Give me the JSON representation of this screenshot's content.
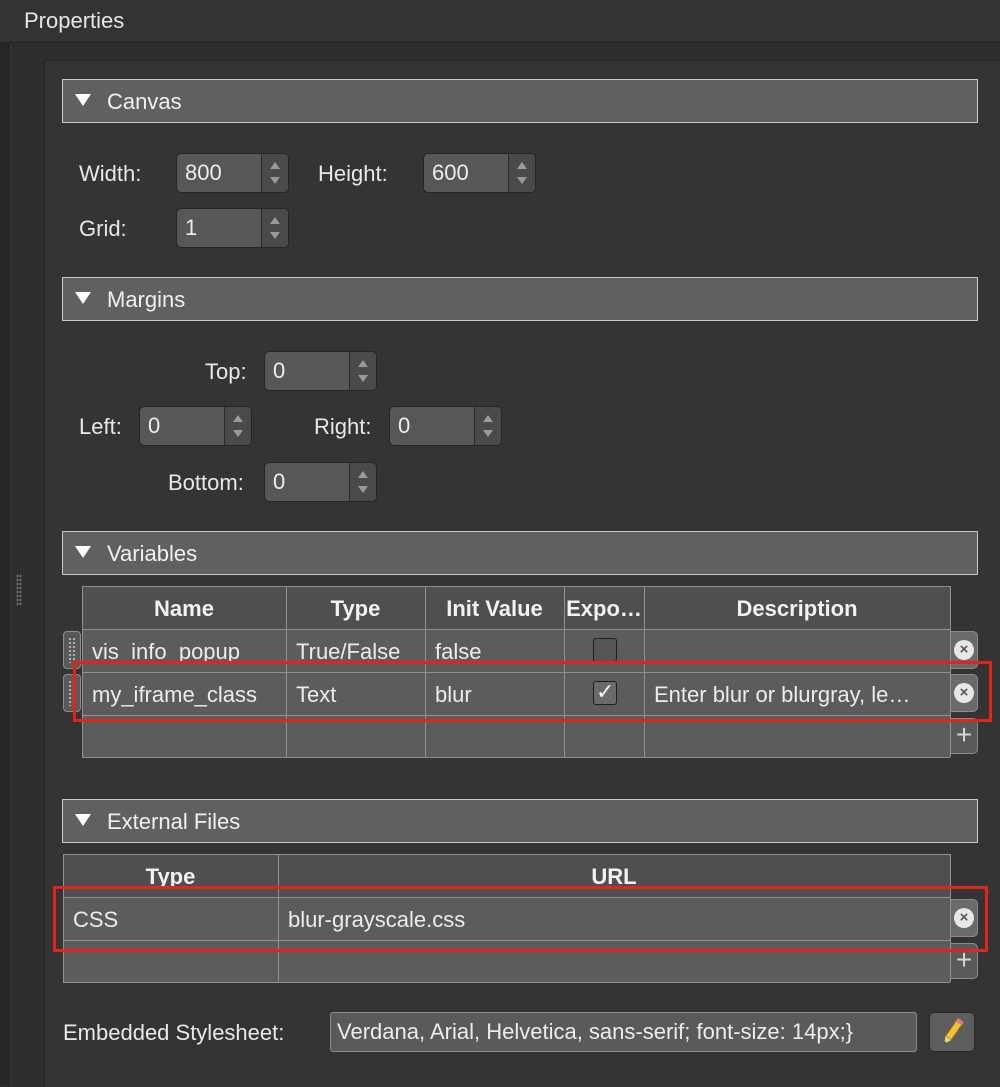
{
  "window": {
    "title": "Properties"
  },
  "canvas": {
    "header": "Canvas",
    "width_label": "Width:",
    "width_value": "800",
    "height_label": "Height:",
    "height_value": "600",
    "grid_label": "Grid:",
    "grid_value": "1"
  },
  "margins": {
    "header": "Margins",
    "top_label": "Top:",
    "top_value": "0",
    "left_label": "Left:",
    "left_value": "0",
    "right_label": "Right:",
    "right_value": "0",
    "bottom_label": "Bottom:",
    "bottom_value": "0"
  },
  "variables": {
    "header": "Variables",
    "columns": [
      "Name",
      "Type",
      "Init Value",
      "Expo…",
      "Description"
    ],
    "rows": [
      {
        "name": "vis_info_popup",
        "type": "True/False",
        "init": "false",
        "exported": false,
        "description": ""
      },
      {
        "name": "my_iframe_class",
        "type": "Text",
        "init": "blur",
        "exported": true,
        "description": "Enter blur or blurgray, le…"
      }
    ],
    "add_label": "+"
  },
  "external_files": {
    "header": "External Files",
    "columns": [
      "Type",
      "URL"
    ],
    "rows": [
      {
        "type": "CSS",
        "url": "blur-grayscale.css"
      }
    ],
    "add_label": "+"
  },
  "embedded_stylesheet": {
    "label": "Embedded Stylesheet:",
    "value": "Verdana, Arial, Helvetica, sans-serif; font-size: 14px;}"
  },
  "icons": {
    "remove": "close-circle-icon",
    "checkmark": "✓",
    "edit": "pencil-icon"
  },
  "colors": {
    "highlight": "#e1251b",
    "background": "#2e2e2e",
    "header": "#606060"
  }
}
